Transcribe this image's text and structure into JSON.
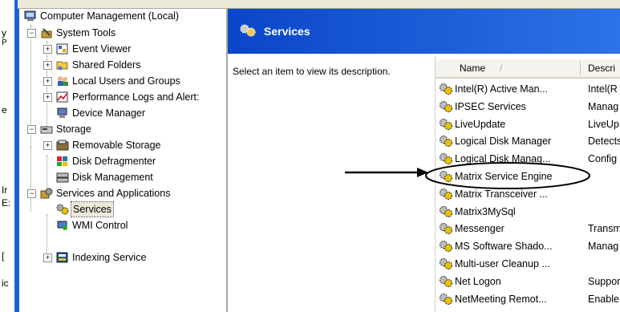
{
  "tree": {
    "root": "Computer Management (Local)",
    "system_tools": "System Tools",
    "event_viewer": "Event Viewer",
    "shared_folders": "Shared Folders",
    "local_users": "Local Users and Groups",
    "perf_logs": "Performance Logs and Alert:",
    "device_manager": "Device Manager",
    "storage": "Storage",
    "removable_storage": "Removable Storage",
    "disk_defrag": "Disk Defragmenter",
    "disk_mgmt": "Disk Management",
    "services_apps": "Services and Applications",
    "services": "Services",
    "wmi": "WMI Control",
    "indexing": "Indexing Service"
  },
  "pane": {
    "title": "Services",
    "description": "Select an item to view its description."
  },
  "list": {
    "col_name": "Name",
    "col_sort_indicator": "/",
    "col_desc": "Descri",
    "rows": [
      {
        "name": "Intel(R) Active Man...",
        "desc": "Intel(R"
      },
      {
        "name": "IPSEC Services",
        "desc": "Manag"
      },
      {
        "name": "LiveUpdate",
        "desc": "LiveUp"
      },
      {
        "name": "Logical Disk Manager",
        "desc": "Detects"
      },
      {
        "name": "Logical Disk Manag...",
        "desc": "Config"
      },
      {
        "name": "Matrix Service Engine",
        "desc": ""
      },
      {
        "name": "Matrix Transceiver ...",
        "desc": ""
      },
      {
        "name": "Matrix3MySql",
        "desc": ""
      },
      {
        "name": "Messenger",
        "desc": "Transm"
      },
      {
        "name": "MS Software Shado...",
        "desc": "Manag"
      },
      {
        "name": "Multi-user Cleanup ...",
        "desc": ""
      },
      {
        "name": "Net Logon",
        "desc": "Suppor"
      },
      {
        "name": "NetMeeting Remot...",
        "desc": "Enable"
      }
    ]
  },
  "edge_chars": [
    "y",
    "P",
    "e",
    "Ir",
    "E:",
    "[",
    "ic"
  ],
  "colors": {
    "accent": "#0a46c8",
    "selection": "#ece9d8"
  }
}
